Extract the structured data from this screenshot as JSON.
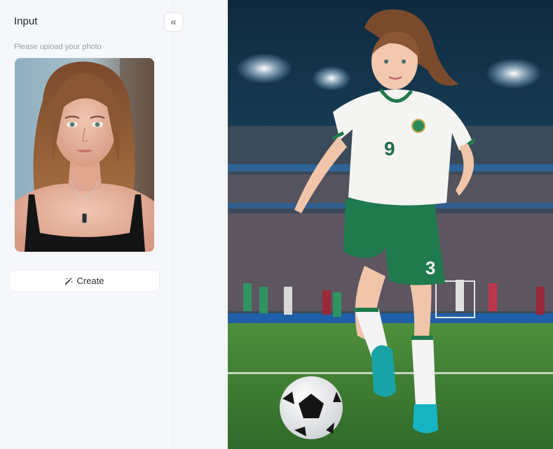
{
  "sidebar": {
    "title": "Input",
    "upload_hint": "Please upload your photo",
    "collapse_icon": "chevrons-left-icon",
    "create_label": "Create",
    "create_icon": "magic-wand-icon"
  },
  "result": {
    "jersey_number_front": "9",
    "jersey_number_shorts": "3"
  },
  "colors": {
    "sidebar_bg": "#f5f7fa",
    "jersey_green": "#1f7a4e",
    "pitch_green": "#3f7f35"
  }
}
